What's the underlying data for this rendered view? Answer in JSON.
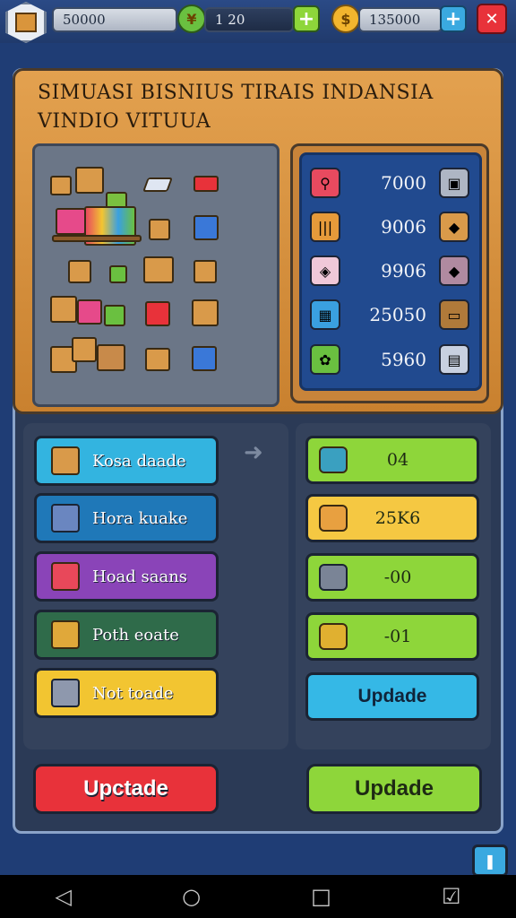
{
  "topbar": {
    "resource1_value": "50000",
    "resource2_value": "1 20",
    "resource2_icon": "trade-coin-icon",
    "resource3_value": "135000",
    "resource3_icon": "gold-coin-icon",
    "plus_symbol": "+",
    "close_symbol": "✕"
  },
  "header": {
    "title_line1": "SIMUASI BISNIUS TIRAIS INDANSIA",
    "title_line2": "VINDIO VITUUA"
  },
  "price_list": [
    {
      "left_icon": "magnifier-icon",
      "value": "7000",
      "right_icon": "crate-icon",
      "lcolor": "#e84a5f",
      "rcolor": "#aeb6c4"
    },
    {
      "left_icon": "barcode-icon",
      "value": "9006",
      "right_icon": "box-icon",
      "lcolor": "#e69a3a",
      "rcolor": "#d99a4a"
    },
    {
      "left_icon": "tag-icon",
      "value": "9906",
      "right_icon": "package-icon",
      "lcolor": "#f0c8d8",
      "rcolor": "#b08aa0"
    },
    {
      "left_icon": "chart-icon",
      "value": "25050",
      "right_icon": "wallet-icon",
      "lcolor": "#3aa0e0",
      "rcolor": "#b07a3a"
    },
    {
      "left_icon": "goods-icon",
      "value": "5960",
      "right_icon": "document-icon",
      "lcolor": "#6ac040",
      "rcolor": "#c8d0e0"
    }
  ],
  "left_buttons": [
    {
      "label": "Kosa daade",
      "icon": "box-icon",
      "bg": "#33b4e0"
    },
    {
      "label": "Hora kuake",
      "icon": "blue-box-icon",
      "bg": "#1f78b8"
    },
    {
      "label": "Hoad saans",
      "icon": "red-box-icon",
      "bg": "#8a44b8"
    },
    {
      "label": "Poth eoate",
      "icon": "gift-box-icon",
      "bg": "#2f6b4a"
    },
    {
      "label": "Not toade",
      "icon": "grey-box-icon",
      "bg": "#f2c531"
    }
  ],
  "arrow_symbol": "➜",
  "right_buttons": [
    {
      "label": "04",
      "icon": "tape-icon",
      "bg": "#8ed63a"
    },
    {
      "label": "25K6",
      "icon": "tape-roll-icon",
      "bg": "#f5c842"
    },
    {
      "label": "-00",
      "icon": "weight-icon",
      "bg": "#8ed63a"
    },
    {
      "label": "-01",
      "icon": "cheese-icon",
      "bg": "#8ed63a"
    },
    {
      "label": "Updade",
      "icon": "",
      "bg": "#35b8e6"
    }
  ],
  "bottom_buttons": {
    "left_label": "Upctade",
    "right_label": "Updade"
  },
  "corner_button_icon": "info-icon",
  "navbar": {
    "back_symbol": "◁",
    "home_symbol": "○",
    "recents_symbol": "□",
    "extra_symbol": "☑"
  },
  "colors": {
    "accent_orange": "#e3a14f",
    "background": "#1f3d75",
    "green": "#8ed63a",
    "red": "#e8323a"
  }
}
